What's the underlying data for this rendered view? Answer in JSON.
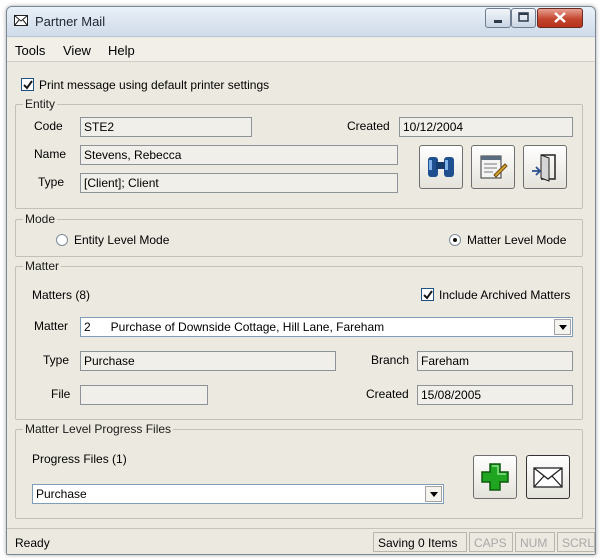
{
  "window": {
    "title": "Partner Mail"
  },
  "menu": [
    "Tools",
    "View",
    "Help"
  ],
  "print_option": {
    "label": "Print message using default printer settings",
    "checked": true
  },
  "entity": {
    "legend": "Entity",
    "code_label": "Code",
    "code_value": "STE2",
    "created_label": "Created",
    "created_value": "10/12/2004",
    "name_label": "Name",
    "name_value": "Stevens, Rebecca",
    "type_label": "Type",
    "type_value": "[Client]; Client"
  },
  "mode": {
    "legend": "Mode",
    "entity_mode_label": "Entity Level Mode",
    "matter_mode_label": "Matter Level Mode",
    "selected": "Matter Level Mode"
  },
  "matter": {
    "legend": "Matter",
    "count_label": "Matters (8)",
    "include_archived_label": "Include Archived Matters",
    "include_archived_checked": true,
    "matter_label": "Matter",
    "matter_selected": "2      Purchase of Downside Cottage, Hill Lane, Fareham",
    "type_label": "Type",
    "type_value": "Purchase",
    "branch_label": "Branch",
    "branch_value": "Fareham",
    "file_label": "File",
    "file_value": "",
    "created_label": "Created",
    "created_value": "15/08/2005"
  },
  "progress": {
    "legend": "Matter Level Progress Files",
    "count_label": "Progress Files (1)",
    "selected": "Purchase"
  },
  "status": {
    "ready": "Ready",
    "saving": "Saving 0 Items",
    "caps": "CAPS",
    "num": "NUM",
    "scrl": "SCRL"
  },
  "colors": {
    "window_bg": "#ece9e0",
    "titlebar": "#cfdbe9",
    "close_button": "#c4462e",
    "add_icon_green": "#1fa51f"
  },
  "icons": [
    "envelope-icon",
    "binoculars-icon",
    "edit-document-icon",
    "exit-door-icon",
    "green-plus-icon",
    "mail-envelope-icon"
  ]
}
